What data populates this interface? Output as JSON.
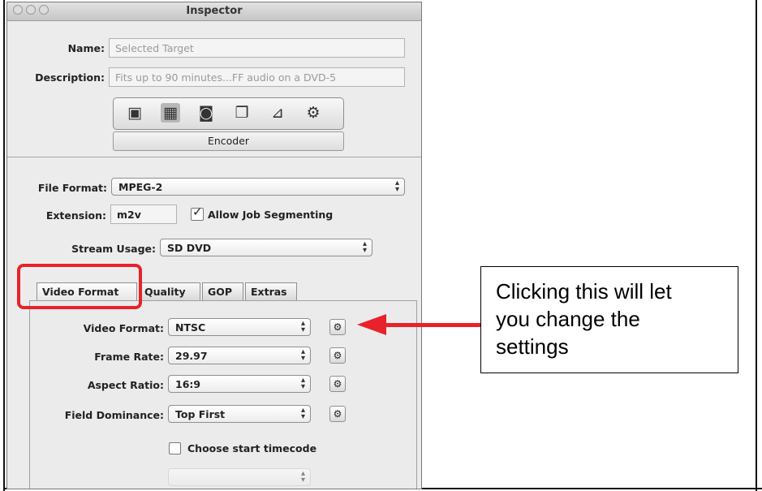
{
  "window": {
    "title": "Inspector"
  },
  "target": {
    "name_label": "Name:",
    "name_value": "Selected Target",
    "description_label": "Description:",
    "description_value": "Fits up to 90 minutes...FF audio on a DVD-5"
  },
  "toolbar": {
    "icons": [
      "summary-icon",
      "encoder-icon",
      "frame-controls-icon",
      "filters-icon",
      "geometry-icon",
      "actions-icon"
    ],
    "encoder_label": "Encoder"
  },
  "format": {
    "file_format_label": "File Format:",
    "file_format_value": "MPEG-2",
    "extension_label": "Extension:",
    "extension_value": "m2v",
    "allow_segmenting_label": "Allow Job Segmenting",
    "allow_segmenting_checked": true,
    "stream_usage_label": "Stream Usage:",
    "stream_usage_value": "SD DVD"
  },
  "tabs": [
    "Video Format",
    "Quality",
    "GOP",
    "Extras"
  ],
  "video": {
    "video_format_label": "Video Format:",
    "video_format_value": "NTSC",
    "frame_rate_label": "Frame Rate:",
    "frame_rate_value": "29.97",
    "aspect_ratio_label": "Aspect Ratio:",
    "aspect_ratio_value": "16:9",
    "field_dominance_label": "Field Dominance:",
    "field_dominance_value": "Top First",
    "start_timecode_label": "Choose start timecode",
    "start_timecode_checked": false
  },
  "callout": {
    "line1": "Clicking this will let",
    "line2": "you change the",
    "line3": "settings"
  },
  "colors": {
    "annotation_red": "#e8222a"
  }
}
